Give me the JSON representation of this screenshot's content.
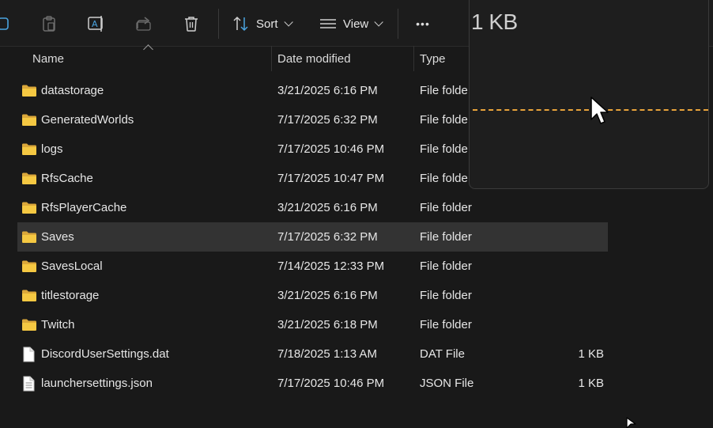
{
  "toolbar": {
    "sort_label": "Sort",
    "view_label": "View",
    "more_label": "•••",
    "icons": [
      "new-icon",
      "paste-icon",
      "rename-icon",
      "share-icon",
      "delete-icon",
      "sort-icon",
      "view-icon",
      "more-icon"
    ]
  },
  "columns": {
    "name": "Name",
    "date_modified": "Date modified",
    "type": "Type"
  },
  "files": [
    {
      "name": "datastorage",
      "date": "3/21/2025 6:16 PM",
      "type": "File folde",
      "size": "",
      "icon": "folder-icon"
    },
    {
      "name": "GeneratedWorlds",
      "date": "7/17/2025 6:32 PM",
      "type": "File folde",
      "size": "",
      "icon": "folder-icon"
    },
    {
      "name": "logs",
      "date": "7/17/2025 10:46 PM",
      "type": "File folde",
      "size": "",
      "icon": "folder-icon"
    },
    {
      "name": "RfsCache",
      "date": "7/17/2025 10:47 PM",
      "type": "File folde",
      "size": "",
      "icon": "folder-icon"
    },
    {
      "name": "RfsPlayerCache",
      "date": "3/21/2025 6:16 PM",
      "type": "File folder",
      "size": "",
      "icon": "folder-icon"
    },
    {
      "name": "Saves",
      "date": "7/17/2025 6:32 PM",
      "type": "File folder",
      "size": "",
      "icon": "folder-icon",
      "selected": true
    },
    {
      "name": "SavesLocal",
      "date": "7/14/2025 12:33 PM",
      "type": "File folder",
      "size": "",
      "icon": "folder-icon"
    },
    {
      "name": "titlestorage",
      "date": "3/21/2025 6:16 PM",
      "type": "File folder",
      "size": "",
      "icon": "folder-icon"
    },
    {
      "name": "Twitch",
      "date": "3/21/2025 6:18 PM",
      "type": "File folder",
      "size": "",
      "icon": "folder-icon"
    },
    {
      "name": "DiscordUserSettings.dat",
      "date": "7/18/2025 1:13 AM",
      "type": "DAT File",
      "size": "1 KB",
      "icon": "file-icon"
    },
    {
      "name": "launchersettings.json",
      "date": "7/17/2025 10:46 PM",
      "type": "JSON File",
      "size": "1 KB",
      "icon": "text-file-icon"
    }
  ],
  "preview": {
    "size_text": "1 KB",
    "accent_color": "#e8a33b"
  },
  "colors": {
    "background": "#191919",
    "selected_row": "#333333",
    "folder": "#f5c842"
  }
}
